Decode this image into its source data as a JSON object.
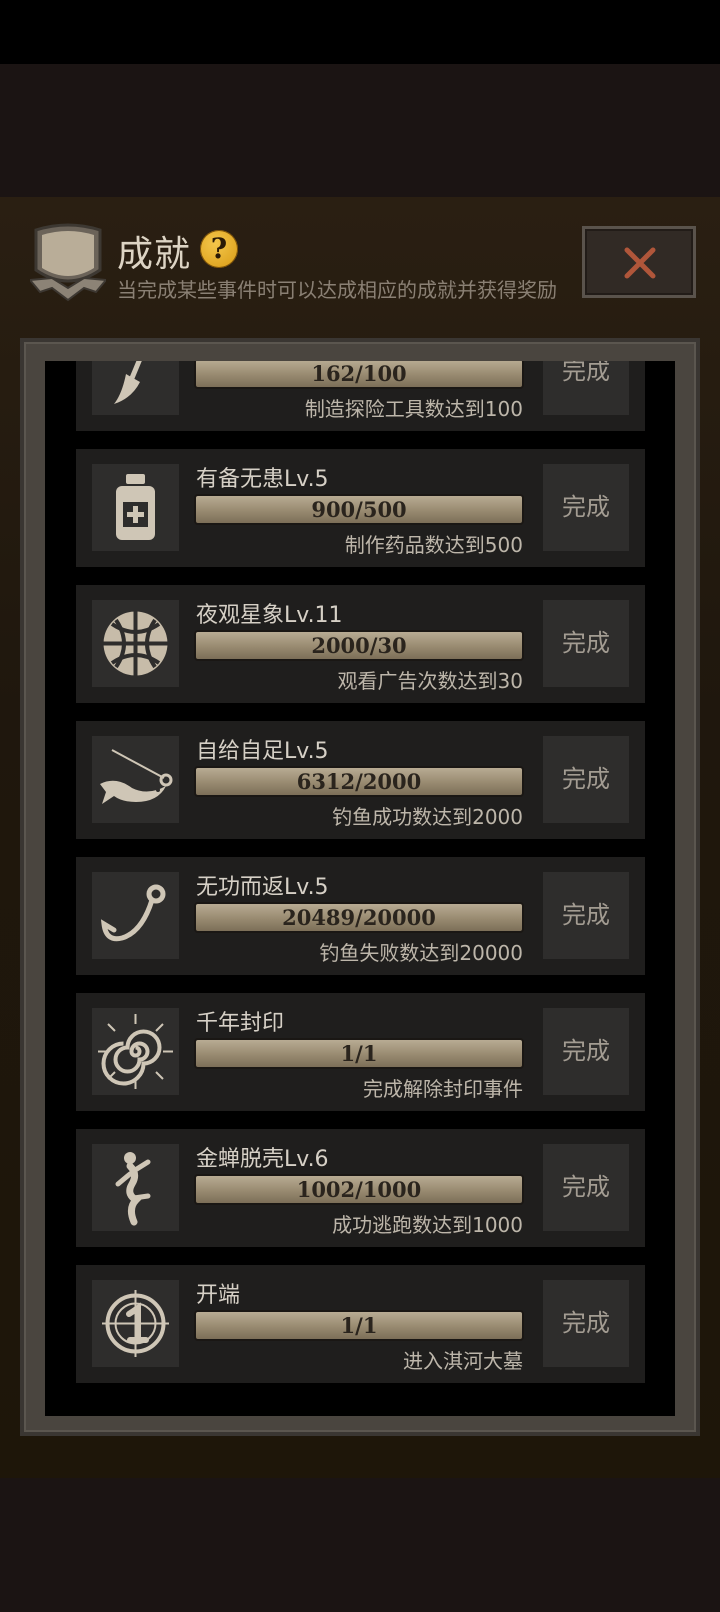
{
  "header": {
    "title": "成就",
    "help_symbol": "?",
    "subtitle": "当完成某些事件时可以达成相应的成就并获得奖励"
  },
  "colors": {
    "accent": "#e4b02a",
    "close_x": "#b0563a",
    "progress_bar": "#a89a80"
  },
  "achievements": [
    {
      "icon": "shovel-icon",
      "name": "",
      "progress": "162/100",
      "description": "制造探险工具数达到100",
      "button": "完成"
    },
    {
      "icon": "medicine-bottle-icon",
      "name": "有备无患Lv.5",
      "progress": "900/500",
      "description": "制作药品数达到500",
      "button": "完成"
    },
    {
      "icon": "globe-icon",
      "name": "夜观星象Lv.11",
      "progress": "2000/30",
      "description": "观看广告次数达到30",
      "button": "完成"
    },
    {
      "icon": "fish-on-hook-icon",
      "name": "自给自足Lv.5",
      "progress": "6312/2000",
      "description": "钓鱼成功数达到2000",
      "button": "完成"
    },
    {
      "icon": "fishing-hook-icon",
      "name": "无功而返Lv.5",
      "progress": "20489/20000",
      "description": "钓鱼失败数达到20000",
      "button": "完成"
    },
    {
      "icon": "seal-spiral-icon",
      "name": "千年封印",
      "progress": "1/1",
      "description": "完成解除封印事件",
      "button": "完成"
    },
    {
      "icon": "escaping-figure-icon",
      "name": "金蝉脱壳Lv.6",
      "progress": "1002/1000",
      "description": "成功逃跑数达到1000",
      "button": "完成"
    },
    {
      "icon": "countdown-one-icon",
      "name": "开端",
      "progress": "1/1",
      "description": "进入淇河大墓",
      "button": "完成"
    }
  ]
}
